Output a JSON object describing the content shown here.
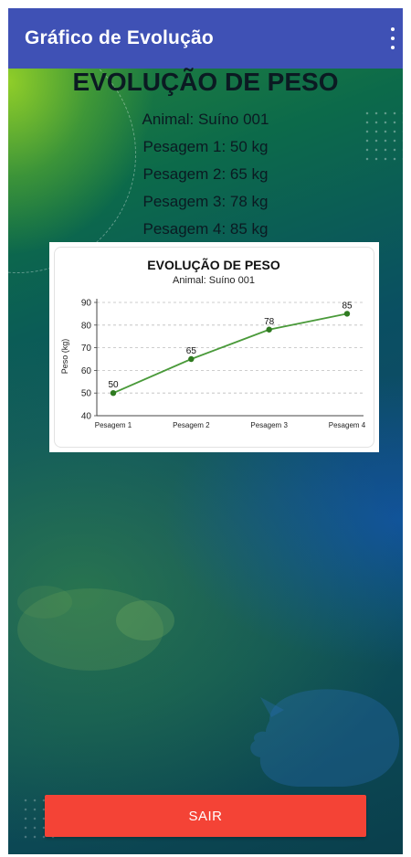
{
  "appbar": {
    "title": "Gráfico de Evolução",
    "menu_icon": "more-vert-icon"
  },
  "heading": "EVOLUÇÃO DE PESO",
  "info": {
    "animal": "Animal: Suíno 001",
    "weighings": [
      "Pesagem 1: 50 kg",
      "Pesagem 2: 65 kg",
      "Pesagem 3: 78 kg",
      "Pesagem 4: 85 kg"
    ]
  },
  "chart_data": {
    "type": "line",
    "title": "EVOLUÇÃO DE PESO",
    "subtitle": "Animal: Suíno 001",
    "ylabel": "Peso (kg)",
    "xlabel": "",
    "categories": [
      "Pesagem 1",
      "Pesagem 2",
      "Pesagem 3",
      "Pesagem 4"
    ],
    "values": [
      50,
      65,
      78,
      85
    ],
    "ylim": [
      40,
      90
    ],
    "yticks": [
      40,
      50,
      60,
      70,
      80,
      90
    ],
    "grid": true,
    "line_color": "#4a9a3a",
    "marker_color": "#2f7a20"
  },
  "button": {
    "exit_label": "SAIR"
  },
  "colors": {
    "appbar": "#3f51b5",
    "exit_button": "#f44336"
  }
}
